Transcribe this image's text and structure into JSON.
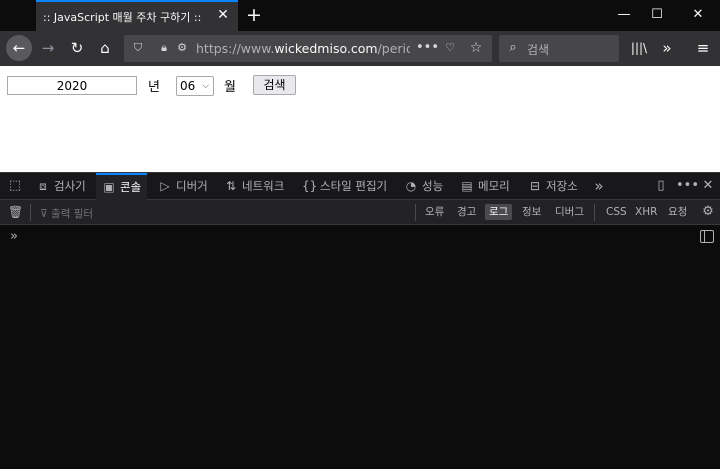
{
  "browser": {
    "tab_title": ":: JavaScript 매월 주차 구하기 ::",
    "url_prefix": "https://www.",
    "url_domain": "wickedmiso.com",
    "url_path": "/period_",
    "search_placeholder": "검색",
    "icons": [
      "close-icon",
      "plus-icon",
      "minimize-icon",
      "maximize-icon",
      "window-close-icon",
      "back-arrow-icon",
      "forward-arrow-icon",
      "reload-icon",
      "home-icon",
      "shield-icon",
      "lock-icon",
      "permissions-icon",
      "more-icon",
      "pocket-icon",
      "star-icon",
      "search-icon",
      "library-icon",
      "overflow-icon",
      "hamburger-menu-icon"
    ]
  },
  "page": {
    "year_value": "2020",
    "year_label": "년",
    "month_value": "06",
    "month_label": "월",
    "search_button": "검색"
  },
  "devtools": {
    "tabs": [
      {
        "label": "검사기",
        "icon": "inspector-icon"
      },
      {
        "label": "콘솔",
        "icon": "console-icon"
      },
      {
        "label": "디버거",
        "icon": "debugger-icon"
      },
      {
        "label": "네트워크",
        "icon": "network-icon"
      },
      {
        "label": "스타일 편집기",
        "icon": "style-editor-icon"
      },
      {
        "label": "성능",
        "icon": "performance-icon"
      },
      {
        "label": "메모리",
        "icon": "memory-icon"
      },
      {
        "label": "저장소",
        "icon": "storage-icon"
      }
    ],
    "active_tab": "콘솔",
    "filter_placeholder": "출력 필터",
    "levels": [
      "오류",
      "경고",
      "로그",
      "정보",
      "디버그"
    ],
    "active_level": "로그",
    "net_filters": [
      "CSS",
      "XHR",
      "요청"
    ],
    "prompt_symbol": "»",
    "accent_color": "#0a84ff"
  }
}
